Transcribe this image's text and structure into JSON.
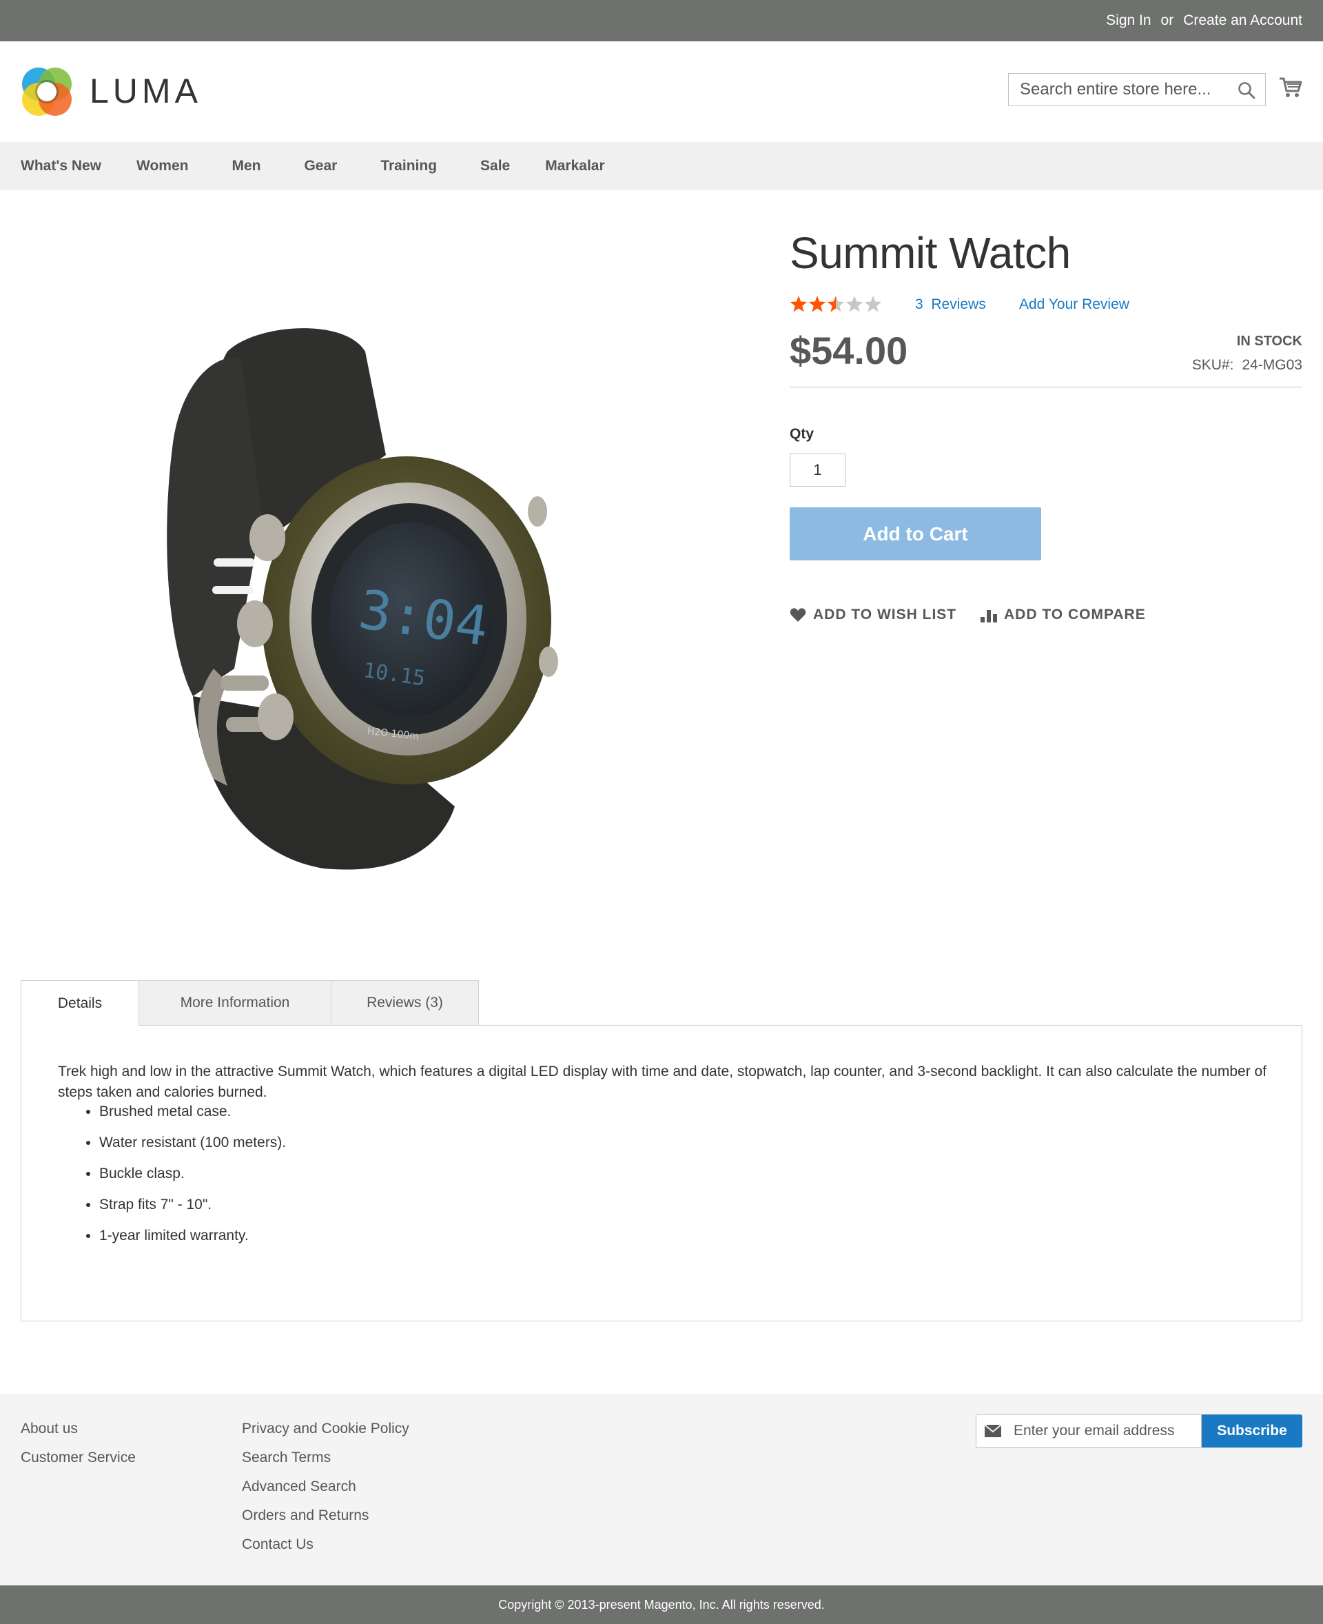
{
  "topbar": {
    "sign_in": "Sign In",
    "or": "or",
    "create_account": "Create an Account"
  },
  "header": {
    "logo_text": "LUMA",
    "search_placeholder": "Search entire store here..."
  },
  "nav": [
    "What's New",
    "Women",
    "Men",
    "Gear",
    "Training",
    "Sale",
    "Markalar"
  ],
  "product": {
    "title": "Summit Watch",
    "rating": {
      "stars_filled": 2.5,
      "stars_total": 5
    },
    "reviews_count": "3",
    "reviews_label": "Reviews",
    "add_review": "Add Your Review",
    "price": "$54.00",
    "stock": "In stock",
    "sku_label": "SKU#:",
    "sku": "24-MG03",
    "qty_label": "Qty",
    "qty_value": "1",
    "add_to_cart": "Add to Cart",
    "wish_list": "ADD TO WISH LIST",
    "compare": "ADD TO COMPARE"
  },
  "tabs": [
    {
      "label": "Details",
      "active": true
    },
    {
      "label": "More Information",
      "active": false
    },
    {
      "label": "Reviews (3)",
      "active": false
    }
  ],
  "details": {
    "description": "Trek high and low in the attractive Summit Watch, which features a digital LED display with time and date, stopwatch, lap counter, and 3-second backlight. It can also calculate the number of steps taken and calories burned.",
    "features": [
      "Brushed metal case.",
      "Water resistant (100 meters).",
      "Buckle clasp.",
      "Strap fits 7\" - 10\".",
      "1-year limited warranty."
    ]
  },
  "footer": {
    "col1": [
      "About us",
      "Customer Service"
    ],
    "col2": [
      "Privacy and Cookie Policy",
      "Search Terms",
      "Advanced Search",
      "Orders and Returns",
      "Contact Us"
    ],
    "email_placeholder": "Enter your email address",
    "subscribe": "Subscribe",
    "copyright": "Copyright © 2013-present Magento, Inc. All rights reserved."
  },
  "colors": {
    "accent": "#1979c3",
    "star": "#ff5501",
    "button_disabled": "#8cbae2",
    "topbar": "#6e716e"
  },
  "icons": [
    "search-icon",
    "cart-icon",
    "heart-icon",
    "compare-icon",
    "envelope-icon",
    "star-icon"
  ]
}
